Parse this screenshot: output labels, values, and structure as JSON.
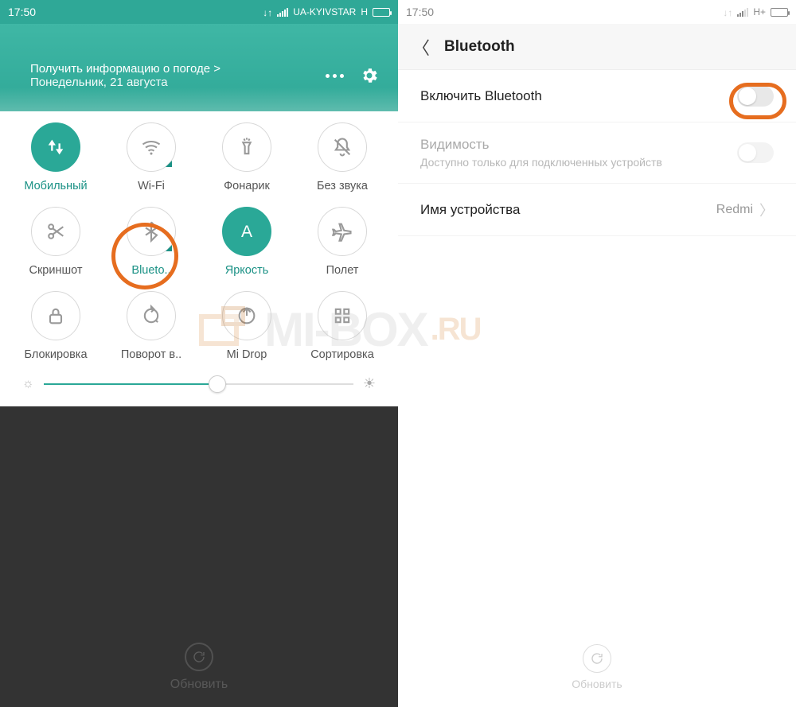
{
  "left": {
    "status": {
      "time": "17:50",
      "carrier": "UA-KYIVSTAR",
      "network": "H"
    },
    "header": {
      "weather_prompt": "Получить информацию о погоде >",
      "date": "Понедельник, 21 августа"
    },
    "tiles": [
      {
        "id": "mobile-data",
        "label": "Мобильный",
        "icon": "data-updown",
        "active": true,
        "expandable": false
      },
      {
        "id": "wifi",
        "label": "Wi-Fi",
        "icon": "wifi",
        "active": false,
        "expandable": true
      },
      {
        "id": "flashlight",
        "label": "Фонарик",
        "icon": "flashlight",
        "active": false,
        "expandable": false
      },
      {
        "id": "mute",
        "label": "Без звука",
        "icon": "bell-off",
        "active": false,
        "expandable": false
      },
      {
        "id": "screenshot",
        "label": "Скриншот",
        "icon": "scissors",
        "active": false,
        "expandable": false
      },
      {
        "id": "bluetooth",
        "label": "Blueto..",
        "icon": "bluetooth",
        "active": false,
        "expandable": true,
        "highlighted": true
      },
      {
        "id": "brightness-tile",
        "label": "Яркость",
        "icon": "letter-a",
        "active": true,
        "expandable": false
      },
      {
        "id": "airplane",
        "label": "Полет",
        "icon": "airplane",
        "active": false,
        "expandable": false
      },
      {
        "id": "lock",
        "label": "Блокировка",
        "icon": "lock",
        "active": false,
        "expandable": false
      },
      {
        "id": "rotate",
        "label": "Поворот в..",
        "icon": "rotate",
        "active": false,
        "expandable": false
      },
      {
        "id": "midrop",
        "label": "Mi Drop",
        "icon": "midrop",
        "active": false,
        "expandable": false
      },
      {
        "id": "sort",
        "label": "Сортировка",
        "icon": "grid",
        "active": false,
        "expandable": false
      }
    ],
    "brightness_percent": 56,
    "refresh_label": "Обновить"
  },
  "right": {
    "status": {
      "time": "17:50",
      "network": "H+"
    },
    "header_title": "Bluetooth",
    "settings": {
      "enable": {
        "title": "Включить Bluetooth",
        "on": false,
        "highlighted": true
      },
      "visibility": {
        "title": "Видимость",
        "subtitle": "Доступно только для подключенных устройств",
        "on": false,
        "enabled": false
      },
      "device_name": {
        "title": "Имя устройства",
        "value": "Redmi"
      }
    },
    "refresh_label": "Обновить"
  },
  "watermark": {
    "text": "MI-BOX",
    "suffix": ".RU"
  },
  "colors": {
    "accent": "#2aa897",
    "highlight": "#e66d1f"
  }
}
